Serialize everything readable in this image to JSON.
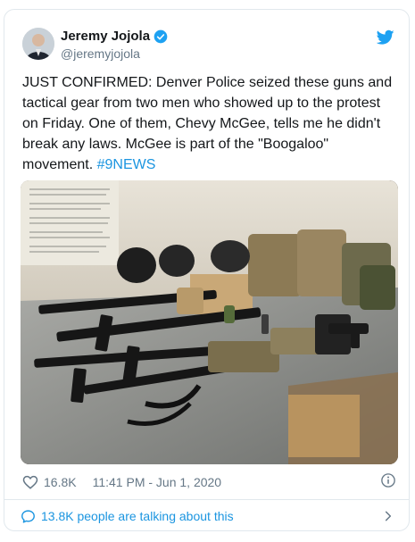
{
  "author": {
    "name": "Jeremy Jojola",
    "handle": "@jeremyjojola",
    "verified": true
  },
  "tweet": {
    "text": "JUST CONFIRMED: Denver Police seized these guns and tactical gear from two men who showed up to the protest on Friday. One of them, Chevy McGee, tells me he didn't break any laws. McGee is part of the \"Boogaloo\" movement. ",
    "hashtag": "#9NEWS"
  },
  "stats": {
    "likes": "16.8K",
    "timestamp": "11:41 PM - Jun 1, 2020"
  },
  "conversation": {
    "label": "13.8K people are talking about this"
  },
  "icons": {
    "platform": "twitter-bird-icon",
    "verified": "verified-badge-icon",
    "like": "heart-icon",
    "info": "info-icon",
    "chat": "chat-bubble-icon",
    "chevron": "chevron-right-icon"
  },
  "colors": {
    "accent": "#1b95e0",
    "muted": "#657786",
    "border": "#e1e8ed"
  }
}
